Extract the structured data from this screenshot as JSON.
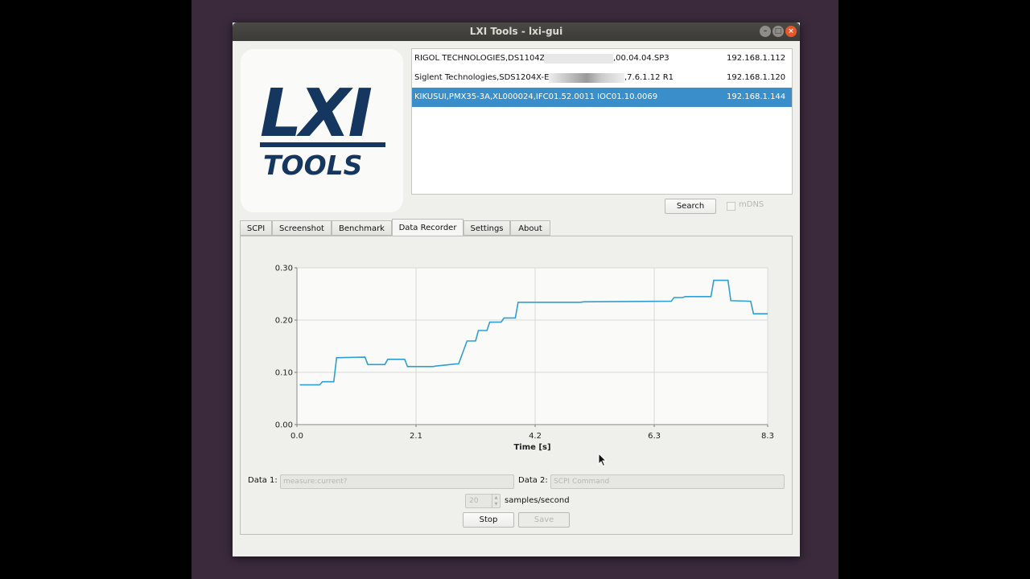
{
  "window": {
    "title": "LXI Tools - lxi-gui"
  },
  "logo": {
    "line1": "LXI",
    "line2": "TOOLS"
  },
  "devices": [
    {
      "name": "RIGOL TECHNOLOGIES,DS1104Z,",
      "name_tail": ",00.04.04.SP3",
      "ip": "192.168.1.112"
    },
    {
      "name": "Siglent Technologies,SDS1204X-E,",
      "name_tail": ",7.6.1.12 R1",
      "ip": "192.168.1.120"
    },
    {
      "name": "KIKUSUI,PMX35-3A,XL000024,IFC01.52.0011 IOC01.10.0069",
      "ip": "192.168.1.144",
      "selected": true
    }
  ],
  "search": {
    "button_label": "Search",
    "mdns_label": "mDNS",
    "mdns_checked": false
  },
  "tabs": [
    "SCPI",
    "Screenshot",
    "Benchmark",
    "Data Recorder",
    "Settings",
    "About"
  ],
  "active_tab": "Data Recorder",
  "chart_data": {
    "type": "line",
    "xlabel": "Time [s]",
    "ylabel": "",
    "xlim": [
      0.0,
      8.3
    ],
    "ylim": [
      0.0,
      0.3
    ],
    "x_ticks": [
      "0.0",
      "2.1",
      "4.2",
      "6.3",
      "8.3"
    ],
    "y_ticks": [
      "0.00",
      "0.10",
      "0.20",
      "0.30"
    ],
    "grid": true,
    "line_color": "#2f9fd3",
    "series": [
      {
        "x": [
          0.05,
          0.4,
          0.45,
          0.65,
          0.7,
          1.2,
          1.25,
          1.55,
          1.6,
          1.9,
          1.95,
          2.4,
          2.45,
          2.8,
          2.85,
          3.0,
          3.05,
          3.15,
          3.2,
          3.35,
          3.4,
          3.6,
          3.65,
          3.85,
          3.9,
          4.15,
          4.2,
          5.0,
          5.05,
          6.6,
          6.65,
          6.8,
          6.85,
          7.3,
          7.35,
          7.6,
          7.65,
          8.0,
          8.05,
          8.3
        ],
        "y": [
          0.076,
          0.076,
          0.082,
          0.082,
          0.128,
          0.129,
          0.115,
          0.115,
          0.125,
          0.125,
          0.111,
          0.111,
          0.112,
          0.116,
          0.116,
          0.16,
          0.16,
          0.16,
          0.18,
          0.18,
          0.196,
          0.196,
          0.204,
          0.204,
          0.234,
          0.234,
          0.234,
          0.234,
          0.235,
          0.236,
          0.243,
          0.243,
          0.245,
          0.245,
          0.276,
          0.276,
          0.237,
          0.236,
          0.212,
          0.212
        ]
      }
    ]
  },
  "recorder": {
    "data1_label": "Data 1:",
    "data1_placeholder": "measure:current?",
    "data2_label": "Data 2:",
    "data2_placeholder": "SCPI Command",
    "rate_value": "20",
    "rate_label": "samples/second",
    "stop_label": "Stop",
    "save_label": "Save"
  }
}
